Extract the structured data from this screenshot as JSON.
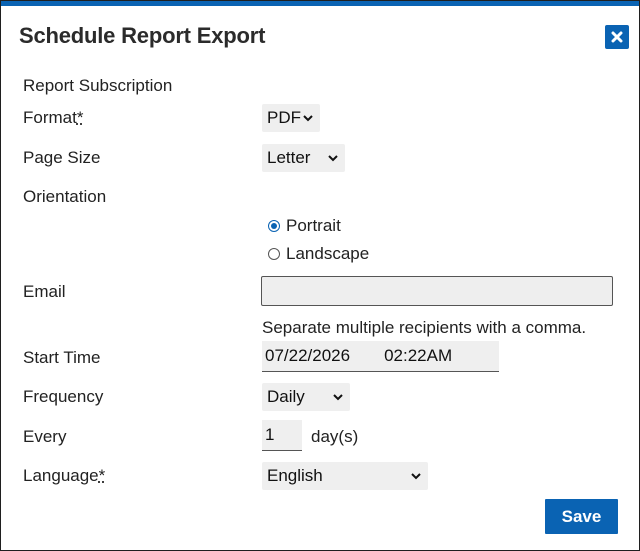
{
  "dialog": {
    "title": "Schedule Report Export",
    "close_icon": "close-icon",
    "accent_color": "#0a63b3"
  },
  "form": {
    "section_title": "Report Subscription",
    "format": {
      "label": "Format",
      "required_mark": "*",
      "value": "PDF"
    },
    "page_size": {
      "label": "Page Size",
      "value": "Letter"
    },
    "orientation": {
      "label": "Orientation",
      "options": [
        {
          "label": "Portrait",
          "selected": true
        },
        {
          "label": "Landscape",
          "selected": false
        }
      ]
    },
    "email": {
      "label": "Email",
      "value": "",
      "hint": "Separate multiple recipients with a comma."
    },
    "start_time": {
      "label": "Start Time",
      "date": "07/22/2026",
      "time": "02:22AM"
    },
    "frequency": {
      "label": "Frequency",
      "value": "Daily"
    },
    "every": {
      "label": "Every",
      "value": "1",
      "unit": "day(s)"
    },
    "language": {
      "label": "Language",
      "required_mark": "*",
      "value": "English"
    }
  },
  "actions": {
    "save_label": "Save"
  }
}
